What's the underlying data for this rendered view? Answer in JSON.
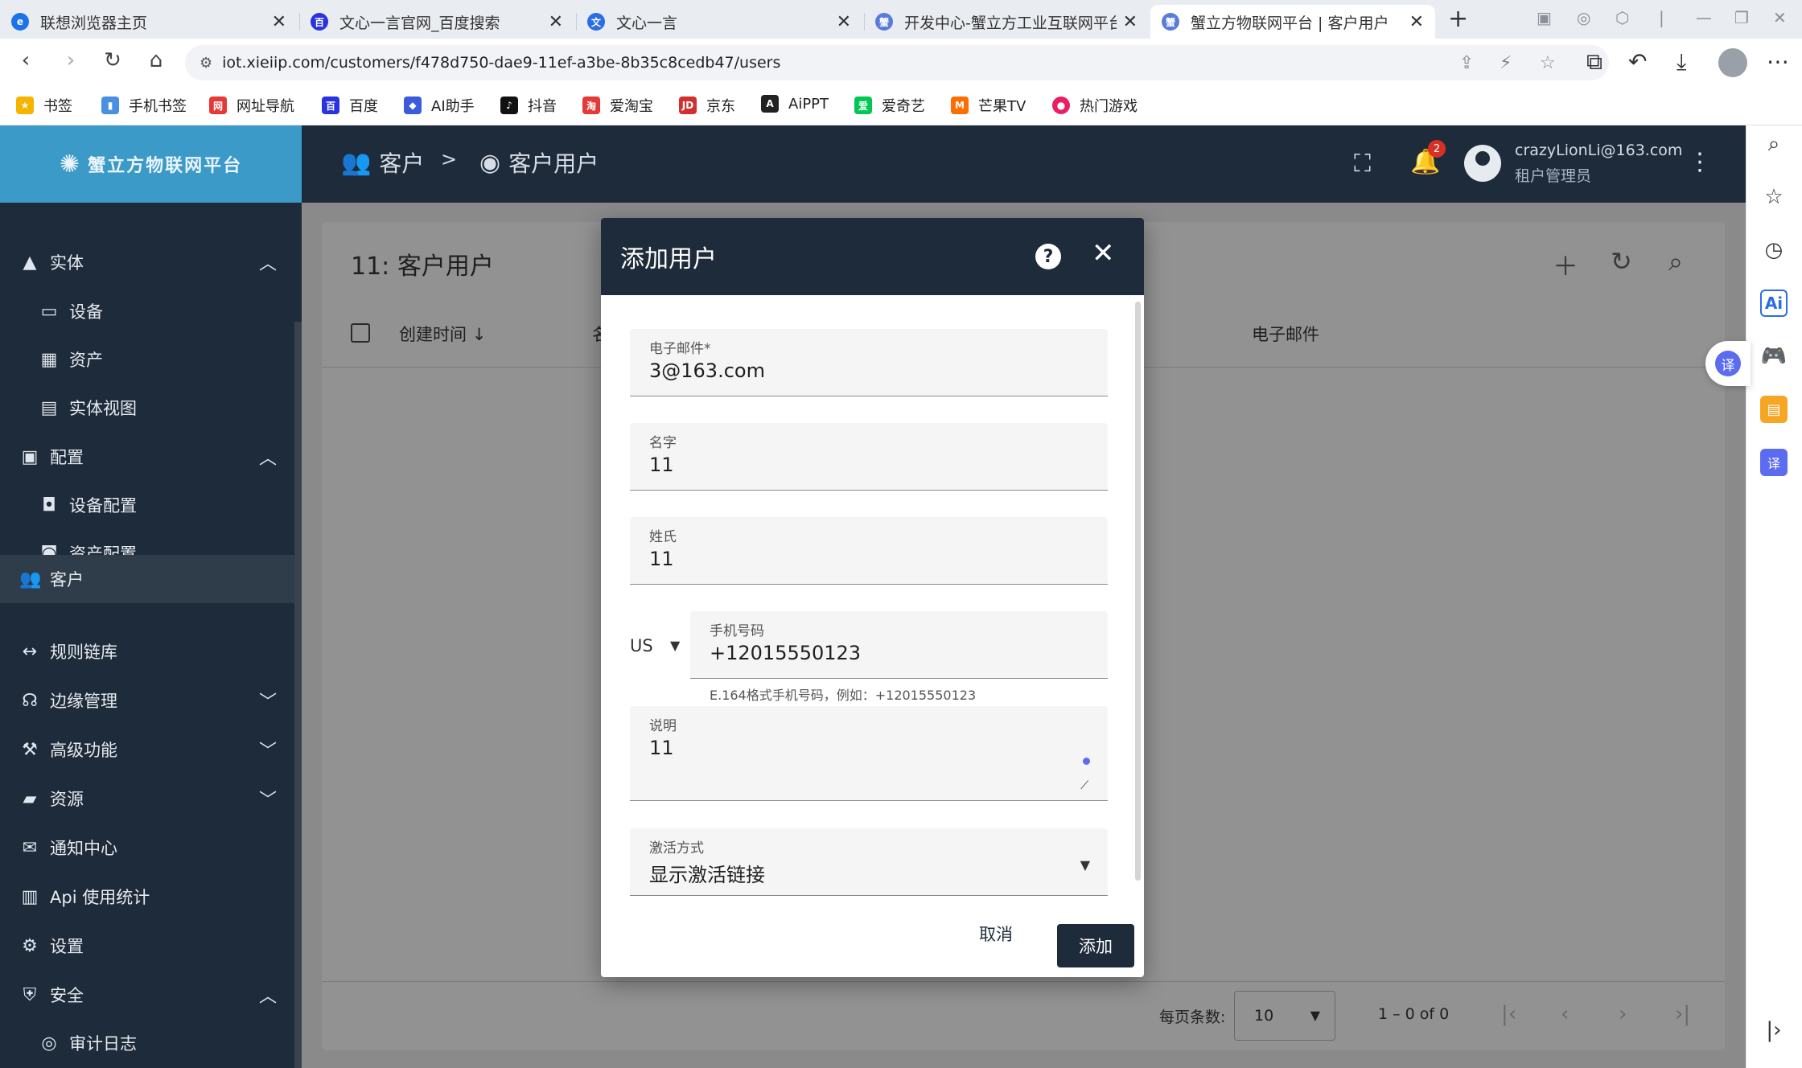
{
  "browser": {
    "tabs": [
      {
        "label": "联想浏览器主页",
        "color": "#1a73e8"
      },
      {
        "label": "文心一言官网_百度搜索",
        "color": "#2932e1"
      },
      {
        "label": "文心一言",
        "color": "#2b6de5"
      },
      {
        "label": "开发中心-蟹立方工业互联网平台",
        "color": "#5a7bd8"
      },
      {
        "label": "蟹立方物联网平台 | 客户用户",
        "color": "#5a7bd8"
      }
    ],
    "url": "iot.xieiip.com/customers/f478d750-dae9-11ef-a3be-8b35c8cedb47/users",
    "bookmarks": [
      {
        "label": "书签",
        "color": "#f4b400"
      },
      {
        "label": "手机书签",
        "color": "#4a90e2"
      },
      {
        "label": "网址导航",
        "color": "#e53935"
      },
      {
        "label": "百度",
        "color": "#2932e1"
      },
      {
        "label": "AI助手",
        "color": "#3b5bdb"
      },
      {
        "label": "抖音",
        "color": "#111111"
      },
      {
        "label": "爱淘宝",
        "color": "#e53935"
      },
      {
        "label": "京东",
        "color": "#d32f2f"
      },
      {
        "label": "AiPPT",
        "color": "#222222"
      },
      {
        "label": "爱奇艺",
        "color": "#00c853"
      },
      {
        "label": "芒果TV",
        "color": "#ff6d00"
      },
      {
        "label": "热门游戏",
        "color": "#e91e63"
      }
    ]
  },
  "header": {
    "logo": "蟹立方物联网平台",
    "breadcrumb": [
      "客户",
      "客户用户"
    ],
    "breadcrumb_sep": ">",
    "notification_count": "2",
    "user_email": "crazyLionLi@163.com",
    "user_role": "租户管理员"
  },
  "sidebar": {
    "items": [
      {
        "label": "实体",
        "icon": "entity-icon",
        "chev": "up"
      },
      {
        "label": "设备",
        "icon": "device-icon",
        "sub": true
      },
      {
        "label": "资产",
        "icon": "asset-icon",
        "sub": true
      },
      {
        "label": "实体视图",
        "icon": "entity-view-icon",
        "sub": true
      },
      {
        "label": "配置",
        "icon": "profiles-icon",
        "chev": "up"
      },
      {
        "label": "设备配置",
        "icon": "device-profile-icon",
        "sub": true
      },
      {
        "label": "资产配置",
        "icon": "asset-profile-icon",
        "sub": true
      },
      {
        "label": "客户",
        "icon": "customers-icon",
        "selected": true
      },
      {
        "label": "规则链库",
        "icon": "rule-chain-icon"
      },
      {
        "label": "边缘管理",
        "icon": "edge-icon",
        "chev": "down"
      },
      {
        "label": "高级功能",
        "icon": "advanced-icon",
        "chev": "down"
      },
      {
        "label": "资源",
        "icon": "folder-icon",
        "chev": "down"
      },
      {
        "label": "通知中心",
        "icon": "notification-center-icon"
      },
      {
        "label": "Api 使用统计",
        "icon": "api-usage-icon"
      },
      {
        "label": "设置",
        "icon": "settings-icon"
      },
      {
        "label": "安全",
        "icon": "security-icon",
        "chev": "up"
      },
      {
        "label": "审计日志",
        "icon": "audit-log-icon",
        "sub": true
      }
    ]
  },
  "main": {
    "title": "11: 客户用户",
    "columns": [
      "创建时间",
      "名",
      "电子邮件"
    ],
    "per_page_label": "每页条数:",
    "per_page_value": "10",
    "range": "1 – 0 of 0"
  },
  "modal": {
    "title": "添加用户",
    "email_label": "电子邮件*",
    "email_value": "3@163.com",
    "firstname_label": "名字",
    "firstname_value": "11",
    "lastname_label": "姓氏",
    "lastname_value": "11",
    "country_code": "US",
    "phone_label": "手机号码",
    "phone_value": "+12015550123",
    "phone_hint": "E.164格式手机号码，例如：+12015550123",
    "desc_label": "说明",
    "desc_value": "11",
    "activation_label": "激活方式",
    "activation_value": "显示激活链接",
    "cancel_label": "取消",
    "add_label": "添加"
  }
}
